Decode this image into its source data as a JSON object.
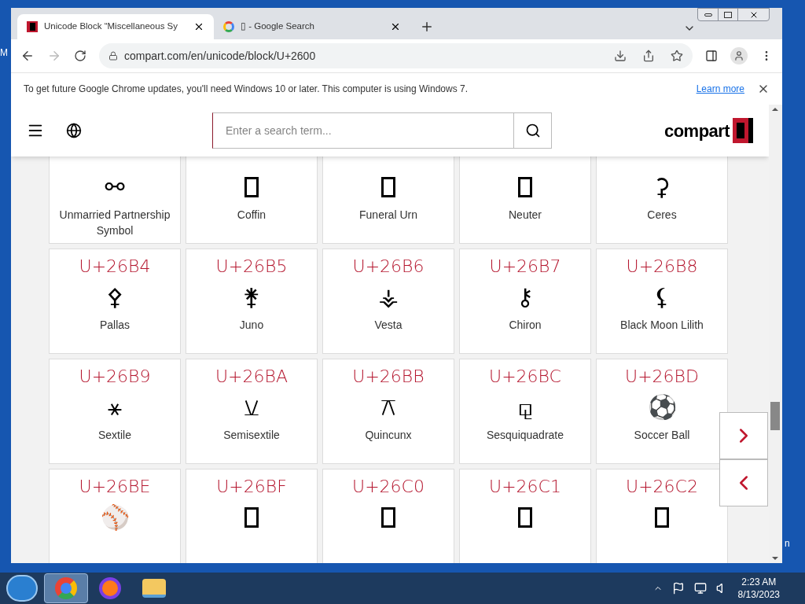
{
  "desktop_fragments": [
    "M",
    "n"
  ],
  "tabs": [
    {
      "title": "Unicode Block “Miscellaneous Sy",
      "selected": true,
      "kind": "site"
    },
    {
      "title": "▯ - Google Search",
      "selected": false,
      "kind": "google"
    }
  ],
  "address": "compart.com/en/unicode/block/U+2600",
  "infobar": {
    "message": "To get future Google Chrome updates, you'll need Windows 10 or later. This computer is using Windows 7.",
    "link": "Learn more"
  },
  "site": {
    "search_placeholder": "Enter a search term...",
    "logo": "compart"
  },
  "cells": [
    {
      "symbol": "⚯",
      "name": "Unmarried Partnership Symbol"
    },
    {
      "kind": "missing",
      "name": "Coffin"
    },
    {
      "kind": "missing",
      "name": "Funeral Urn"
    },
    {
      "kind": "missing",
      "name": "Neuter"
    },
    {
      "symbol": "⚳",
      "name": "Ceres"
    },
    {
      "code": "U+26B4",
      "symbol": "⚴",
      "name": "Pallas"
    },
    {
      "code": "U+26B5",
      "symbol": "⚵",
      "name": "Juno"
    },
    {
      "code": "U+26B6",
      "symbol": "⚶",
      "name": "Vesta"
    },
    {
      "code": "U+26B7",
      "symbol": "⚷",
      "name": "Chiron"
    },
    {
      "code": "U+26B8",
      "symbol": "⚸",
      "name": "Black Moon Lilith"
    },
    {
      "code": "U+26B9",
      "symbol": "⚹",
      "name": "Sextile"
    },
    {
      "code": "U+26BA",
      "symbol": "⚺",
      "name": "Semisextile"
    },
    {
      "code": "U+26BB",
      "symbol": "⚻",
      "name": "Quincunx"
    },
    {
      "code": "U+26BC",
      "symbol": "⚼",
      "name": "Sesquiquadrate"
    },
    {
      "code": "U+26BD",
      "symbol": "⚽",
      "name": "Soccer Ball"
    },
    {
      "code": "U+26BE",
      "symbol": "⚾"
    },
    {
      "code": "U+26BF",
      "kind": "missing"
    },
    {
      "code": "U+26C0",
      "kind": "missing"
    },
    {
      "code": "U+26C1",
      "kind": "missing"
    },
    {
      "code": "U+26C2",
      "kind": "missing"
    }
  ],
  "clock": {
    "time": "2:23 AM",
    "date": "8/13/2023"
  }
}
